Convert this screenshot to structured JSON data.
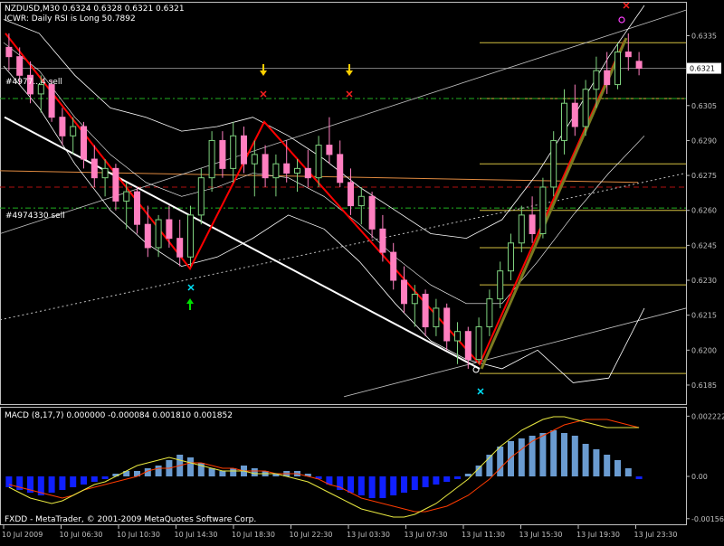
{
  "header": {
    "symbol_line": "NZDUSD,M30  0.6324 0.6328 0.6321 0.6321",
    "indicator_line": "ICWR: Daily RSI is Long 50.7892"
  },
  "labels": {
    "order_sell_1": "#4977...4 sell",
    "order_sell_2": "#4974330 sell",
    "macd_title": "MACD  (8,17,7) 0.000000 -0.000084 0.001810 0.001852",
    "footer": "FXDD - MetaTrader, © 2001-2009 MetaQuotes Software Corp."
  },
  "colors": {
    "background": "#000000",
    "axis": "#c0c0c0",
    "bull_candle": "#7fd27f",
    "bear_candle": "#ff7fc0",
    "bands": "#ffffff",
    "zigzag": "#ff0000",
    "fib": "#d4c040",
    "macd_pos": "#6a9bd0",
    "macd_neg": "#1020ff",
    "macd_signal": "#ff3b00",
    "macd_main": "#e8e840",
    "arrow_down": "#ffd000",
    "arrow_up": "#00e000",
    "cross_mark": "#ff2020",
    "cyan_mark": "#00e5ff"
  },
  "chart_data": [
    {
      "type": "candlestick",
      "title": "NZDUSD,M30",
      "ylim": [
        0.6178,
        0.6348
      ],
      "price_ticks": [
        "0.6335",
        "0.6321",
        "0.6305",
        "0.6290",
        "0.6275",
        "0.6260",
        "0.6245",
        "0.6230",
        "0.6215",
        "0.6200",
        "0.6185"
      ],
      "current_price": "0.6321",
      "x_ticks": [
        "10 Jul 2009",
        "10 Jul 06:30",
        "10 Jul 10:30",
        "10 Jul 14:30",
        "10 Jul 18:30",
        "10 Jul 22:30",
        "13 Jul 03:30",
        "13 Jul 07:30",
        "13 Jul 11:30",
        "13 Jul 15:30",
        "13 Jul 19:30",
        "13 Jul 23:30"
      ],
      "ohlc": [
        [
          0.633,
          0.6336,
          0.632,
          0.6326
        ],
        [
          0.6326,
          0.633,
          0.6314,
          0.6318
        ],
        [
          0.6318,
          0.6324,
          0.6306,
          0.631
        ],
        [
          0.631,
          0.6318,
          0.6302,
          0.6314
        ],
        [
          0.6314,
          0.6316,
          0.6298,
          0.63
        ],
        [
          0.63,
          0.6304,
          0.6288,
          0.6292
        ],
        [
          0.6292,
          0.63,
          0.6284,
          0.6296
        ],
        [
          0.6296,
          0.6298,
          0.6278,
          0.6282
        ],
        [
          0.6282,
          0.6288,
          0.627,
          0.6274
        ],
        [
          0.6274,
          0.6282,
          0.6266,
          0.6278
        ],
        [
          0.6278,
          0.628,
          0.626,
          0.6264
        ],
        [
          0.6264,
          0.6272,
          0.6252,
          0.6268
        ],
        [
          0.6268,
          0.627,
          0.625,
          0.6254
        ],
        [
          0.6254,
          0.6262,
          0.624,
          0.6244
        ],
        [
          0.6244,
          0.6258,
          0.624,
          0.6256
        ],
        [
          0.6256,
          0.6262,
          0.6244,
          0.6248
        ],
        [
          0.6248,
          0.6256,
          0.6236,
          0.624
        ],
        [
          0.624,
          0.6262,
          0.6236,
          0.6258
        ],
        [
          0.6258,
          0.6278,
          0.6254,
          0.6274
        ],
        [
          0.6274,
          0.6294,
          0.6268,
          0.629
        ],
        [
          0.629,
          0.6294,
          0.6274,
          0.6278
        ],
        [
          0.6278,
          0.6298,
          0.6272,
          0.6292
        ],
        [
          0.6292,
          0.6296,
          0.6276,
          0.628
        ],
        [
          0.628,
          0.629,
          0.6266,
          0.6284
        ],
        [
          0.6284,
          0.6288,
          0.627,
          0.6274
        ],
        [
          0.6274,
          0.6284,
          0.6266,
          0.628
        ],
        [
          0.628,
          0.629,
          0.6272,
          0.6276
        ],
        [
          0.6276,
          0.6282,
          0.6268,
          0.6278
        ],
        [
          0.6278,
          0.6286,
          0.627,
          0.6274
        ],
        [
          0.6274,
          0.6292,
          0.627,
          0.6288
        ],
        [
          0.6288,
          0.63,
          0.628,
          0.6284
        ],
        [
          0.6284,
          0.629,
          0.627,
          0.6272
        ],
        [
          0.6272,
          0.6278,
          0.6258,
          0.6262
        ],
        [
          0.6262,
          0.627,
          0.6254,
          0.6266
        ],
        [
          0.6266,
          0.6268,
          0.6248,
          0.6252
        ],
        [
          0.6252,
          0.6258,
          0.6238,
          0.6242
        ],
        [
          0.6242,
          0.6246,
          0.6226,
          0.623
        ],
        [
          0.623,
          0.6236,
          0.6216,
          0.622
        ],
        [
          0.622,
          0.6228,
          0.621,
          0.6224
        ],
        [
          0.6224,
          0.6226,
          0.6206,
          0.621
        ],
        [
          0.621,
          0.6222,
          0.6206,
          0.6218
        ],
        [
          0.6218,
          0.622,
          0.62,
          0.6204
        ],
        [
          0.6204,
          0.6212,
          0.6194,
          0.6208
        ],
        [
          0.6208,
          0.621,
          0.6192,
          0.6196
        ],
        [
          0.6196,
          0.6214,
          0.6194,
          0.621
        ],
        [
          0.621,
          0.6226,
          0.6206,
          0.6222
        ],
        [
          0.6222,
          0.6238,
          0.6218,
          0.6234
        ],
        [
          0.6234,
          0.625,
          0.623,
          0.6246
        ],
        [
          0.6246,
          0.6262,
          0.6242,
          0.6258
        ],
        [
          0.6258,
          0.6266,
          0.6246,
          0.625
        ],
        [
          0.625,
          0.6274,
          0.6248,
          0.627
        ],
        [
          0.627,
          0.6294,
          0.6266,
          0.629
        ],
        [
          0.629,
          0.6312,
          0.6284,
          0.6306
        ],
        [
          0.6306,
          0.6314,
          0.6292,
          0.6296
        ],
        [
          0.6296,
          0.6316,
          0.6292,
          0.6312
        ],
        [
          0.6312,
          0.6326,
          0.6304,
          0.632
        ],
        [
          0.632,
          0.6328,
          0.631,
          0.6314
        ],
        [
          0.6314,
          0.6332,
          0.6312,
          0.6328
        ],
        [
          0.6328,
          0.6336,
          0.632,
          0.6326
        ],
        [
          0.6324,
          0.6328,
          0.6318,
          0.6321
        ]
      ]
    },
    {
      "type": "bar",
      "title": "MACD (8,17,7)",
      "ylim": [
        -0.0017,
        0.0024
      ],
      "y_ticks": [
        "0.002222",
        "0.00",
        "-0.00156"
      ],
      "histogram": [
        -0.0004,
        -0.0005,
        -0.0006,
        -0.0007,
        -0.0006,
        -0.0005,
        -0.0004,
        -0.0003,
        -0.0002,
        -0.0001,
        0.0001,
        0.0002,
        0.0002,
        0.0003,
        0.0004,
        0.0006,
        0.0008,
        0.0007,
        0.0005,
        0.0003,
        0.0002,
        0.0003,
        0.0004,
        0.0003,
        0.0002,
        0.0001,
        0.0002,
        0.0002,
        0.0001,
        -0.0001,
        -0.0003,
        -0.0005,
        -0.0006,
        -0.0007,
        -0.0008,
        -0.0008,
        -0.0007,
        -0.0006,
        -0.0005,
        -0.0004,
        -0.0003,
        -0.0002,
        -0.0001,
        0.0001,
        0.0004,
        0.0008,
        0.0011,
        0.0013,
        0.0014,
        0.0015,
        0.0016,
        0.0017,
        0.0016,
        0.0015,
        0.0012,
        0.001,
        0.0008,
        0.0006,
        0.0003,
        -0.0001
      ],
      "signal": [
        -0.0003,
        -0.0004,
        -0.0005,
        -0.0006,
        -0.0007,
        -0.0008,
        -0.0007,
        -0.0005,
        -0.0004,
        -0.0003,
        -0.0002,
        -0.0001,
        0.0,
        0.0002,
        0.0003,
        0.0003,
        0.0004,
        0.0005,
        0.0005,
        0.0004,
        0.0003,
        0.0003,
        0.0002,
        0.0002,
        0.0002,
        0.0001,
        0.0001,
        0.0001,
        0.0,
        -0.0001,
        -0.0003,
        -0.0004,
        -0.0006,
        -0.0008,
        -0.0009,
        -0.001,
        -0.0011,
        -0.0012,
        -0.0013,
        -0.0013,
        -0.0012,
        -0.0011,
        -0.0009,
        -0.0007,
        -0.0004,
        -0.0001,
        0.0003,
        0.0007,
        0.001,
        0.0013,
        0.0015,
        0.0017,
        0.0019,
        0.002,
        0.0021,
        0.0021,
        0.0021,
        0.002,
        0.0019,
        0.0018
      ],
      "main": [
        -0.0004,
        -0.0006,
        -0.0008,
        -0.0009,
        -0.001,
        -0.0009,
        -0.0007,
        -0.0005,
        -0.0003,
        -0.0002,
        0.0,
        0.0002,
        0.0004,
        0.0005,
        0.0006,
        0.0007,
        0.0006,
        0.0005,
        0.0004,
        0.0003,
        0.0002,
        0.0002,
        0.0002,
        0.0001,
        0.0001,
        0.0001,
        0.0,
        -0.0001,
        -0.0002,
        -0.0004,
        -0.0006,
        -0.0008,
        -0.001,
        -0.0012,
        -0.0013,
        -0.0014,
        -0.0015,
        -0.0015,
        -0.0014,
        -0.0012,
        -0.001,
        -0.0007,
        -0.0004,
        -0.0001,
        0.0003,
        0.0007,
        0.0011,
        0.0014,
        0.0017,
        0.0019,
        0.0021,
        0.0022,
        0.0022,
        0.0021,
        0.002,
        0.0019,
        0.0018,
        0.0018,
        0.0018,
        0.0018
      ]
    }
  ]
}
